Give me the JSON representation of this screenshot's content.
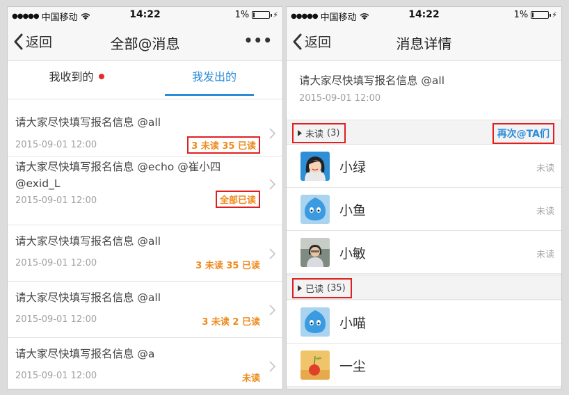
{
  "status_bar": {
    "dots": "●●●●●",
    "carrier": "中国移动",
    "time": "14:22",
    "battery": "1%"
  },
  "left_screen": {
    "back_label": "返回",
    "title": "全部@消息",
    "more_label": "•••",
    "tabs": [
      {
        "label": "我收到的"
      },
      {
        "label": "我发出的"
      }
    ],
    "messages": [
      {
        "text": "请大家尽快填写报名信息  @all",
        "time": "2015-09-01 12:00",
        "status": "3 未读  35 已读"
      },
      {
        "text": "请大家尽快填写报名信息  @echo   @崔小四",
        "text2": "@exid_L",
        "time": "2015-09-01 12:00",
        "status": "全部已读"
      },
      {
        "text": "请大家尽快填写报名信息  @all",
        "time": "2015-09-01 12:00",
        "status": "3 未读  35 已读"
      },
      {
        "text": "请大家尽快填写报名信息  @all",
        "time": "2015-09-01 12:00",
        "status": "3 未读  2 已读"
      },
      {
        "text": "请大家尽快填写报名信息  @a",
        "time": "2015-09-01 12:00",
        "status": "未读"
      }
    ]
  },
  "right_screen": {
    "back_label": "返回",
    "title": "消息详情",
    "message": {
      "text": "请大家尽快填写报名信息  @all",
      "time": "2015-09-01 12:00"
    },
    "unread_section": {
      "label": "未读",
      "count": "(3)",
      "action_label": "再次@TA们"
    },
    "read_section": {
      "label": "已读",
      "count": "(35)"
    },
    "unread_people": [
      {
        "name": "小绿",
        "state": "未读"
      },
      {
        "name": "小鱼",
        "state": "未读"
      },
      {
        "name": "小敏",
        "state": "未读"
      }
    ],
    "read_people": [
      {
        "name": "小喵"
      },
      {
        "name": "一尘"
      }
    ]
  },
  "colors": {
    "accent_blue": "#2a8bd8",
    "status_orange": "#ee8a1c",
    "highlight_red": "#e02020",
    "unread_dot": "#e42b2b"
  },
  "icons": [
    "wifi-icon",
    "battery-icon",
    "bolt-icon",
    "chevron-left-icon",
    "more-icon",
    "chevron-right-icon",
    "triangle-right-icon",
    "avatar"
  ]
}
